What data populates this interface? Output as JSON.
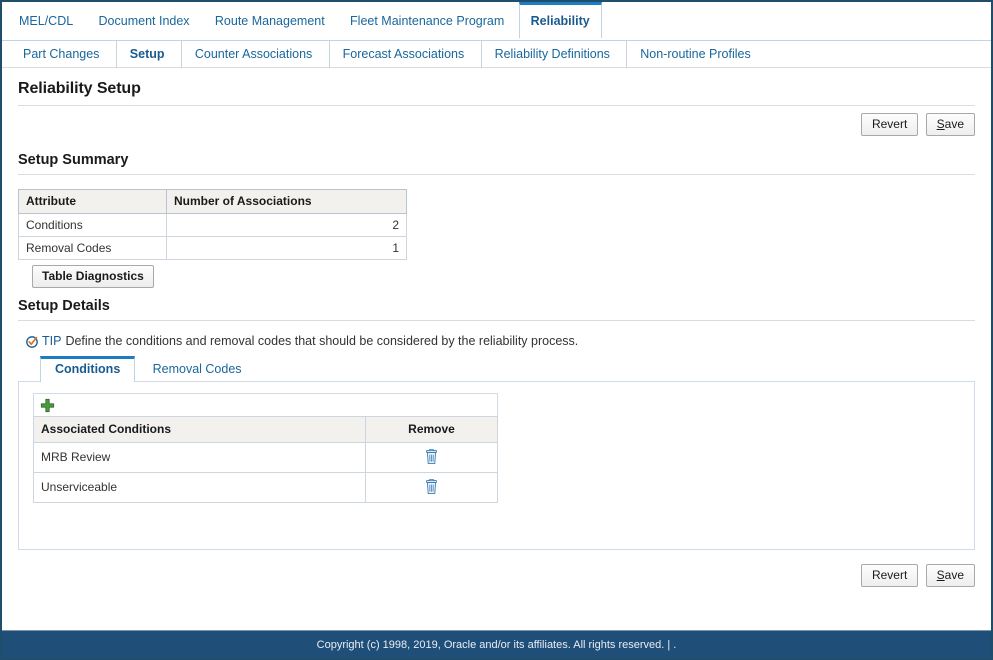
{
  "top_tabs": [
    {
      "label": "MEL/CDL",
      "selected": false
    },
    {
      "label": "Document Index",
      "selected": false
    },
    {
      "label": "Route Management",
      "selected": false
    },
    {
      "label": "Fleet Maintenance Program",
      "selected": false
    },
    {
      "label": "Reliability",
      "selected": true
    }
  ],
  "sub_tabs": [
    {
      "label": "Part Changes",
      "selected": false
    },
    {
      "label": "Setup",
      "selected": true
    },
    {
      "label": "Counter Associations",
      "selected": false
    },
    {
      "label": "Forecast Associations",
      "selected": false
    },
    {
      "label": "Reliability Definitions",
      "selected": false
    },
    {
      "label": "Non-routine Profiles",
      "selected": false
    }
  ],
  "page": {
    "title": "Reliability Setup"
  },
  "actions": {
    "revert_label": "Revert",
    "save_label_prefix": "S",
    "save_label_rest": "ave"
  },
  "summary": {
    "heading": "Setup Summary",
    "columns": [
      "Attribute",
      "Number of Associations"
    ],
    "rows": [
      {
        "attribute": "Conditions",
        "count": "2"
      },
      {
        "attribute": "Removal Codes",
        "count": "1"
      }
    ],
    "diagnostics_label": "Table Diagnostics"
  },
  "details": {
    "heading": "Setup Details",
    "tip_label": "TIP",
    "tip_text": "Define the conditions and removal codes that should be considered by the reliability process.",
    "tabs": [
      {
        "label": "Conditions",
        "selected": true
      },
      {
        "label": "Removal Codes",
        "selected": false
      }
    ],
    "table": {
      "columns": [
        "Associated Conditions",
        "Remove"
      ],
      "rows": [
        {
          "name": "MRB Review"
        },
        {
          "name": "Unserviceable"
        }
      ]
    }
  },
  "footer": {
    "copyright": "Copyright (c) 1998, 2019, Oracle and/or its affiliates. All rights reserved. | ."
  },
  "colors": {
    "link_blue": "#19679c",
    "tab_accent": "#1d7dc2",
    "footer_bg": "#1f4e79",
    "frame_border": "#1f4e6b",
    "header_bg": "#f2f1ee",
    "add_green": "#4a9a3c",
    "trash_blue": "#3f7fb5"
  }
}
